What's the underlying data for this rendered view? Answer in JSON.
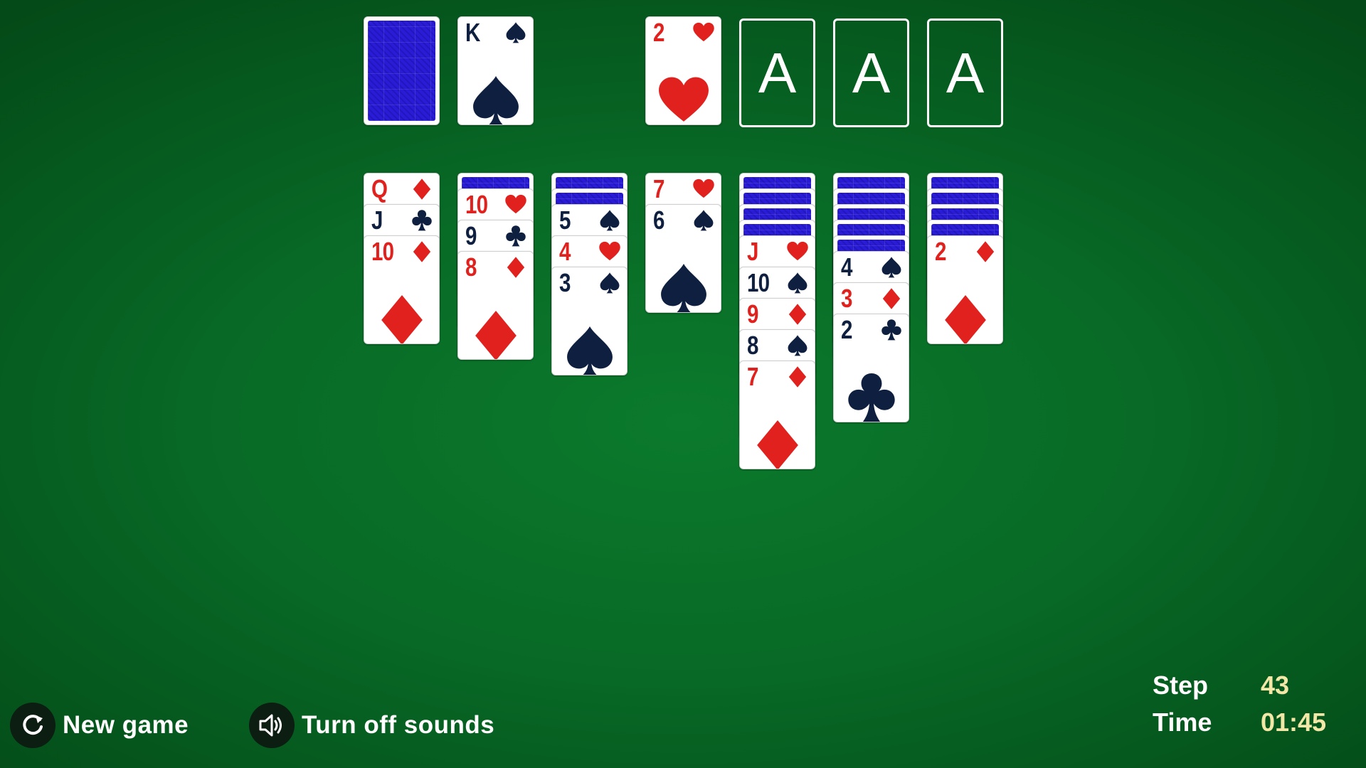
{
  "game": "Solitaire",
  "colors": {
    "table": "#086a26",
    "card_back": "#2a1cd6",
    "red_suit": "#e0211d",
    "black_suit": "#0e1f40",
    "stat_value": "#f2e7a6"
  },
  "stock": {
    "face_down": true
  },
  "waste": {
    "rank": "K",
    "suit": "spade"
  },
  "foundations": [
    {
      "rank": "2",
      "suit": "heart"
    },
    {
      "placeholder": "A"
    },
    {
      "placeholder": "A"
    },
    {
      "placeholder": "A"
    }
  ],
  "tableau": [
    {
      "hidden": 0,
      "cards": [
        {
          "rank": "Q",
          "suit": "diamond"
        },
        {
          "rank": "J",
          "suit": "club"
        },
        {
          "rank": "10",
          "suit": "diamond"
        }
      ]
    },
    {
      "hidden": 1,
      "cards": [
        {
          "rank": "10",
          "suit": "heart"
        },
        {
          "rank": "9",
          "suit": "club"
        },
        {
          "rank": "8",
          "suit": "diamond"
        }
      ]
    },
    {
      "hidden": 2,
      "cards": [
        {
          "rank": "5",
          "suit": "spade"
        },
        {
          "rank": "4",
          "suit": "heart"
        },
        {
          "rank": "3",
          "suit": "spade"
        }
      ]
    },
    {
      "hidden": 0,
      "cards": [
        {
          "rank": "7",
          "suit": "heart"
        },
        {
          "rank": "6",
          "suit": "spade"
        }
      ]
    },
    {
      "hidden": 4,
      "cards": [
        {
          "rank": "J",
          "suit": "heart"
        },
        {
          "rank": "10",
          "suit": "spade"
        },
        {
          "rank": "9",
          "suit": "diamond"
        },
        {
          "rank": "8",
          "suit": "spade"
        },
        {
          "rank": "7",
          "suit": "diamond"
        }
      ]
    },
    {
      "hidden": 5,
      "cards": [
        {
          "rank": "4",
          "suit": "spade"
        },
        {
          "rank": "3",
          "suit": "diamond"
        },
        {
          "rank": "2",
          "suit": "club"
        }
      ]
    },
    {
      "hidden": 4,
      "cards": [
        {
          "rank": "2",
          "suit": "diamond"
        }
      ]
    }
  ],
  "controls": {
    "new_game_label": "New game",
    "new_game_icon": "refresh-icon",
    "sound_label": "Turn off sounds",
    "sound_icon": "speaker-icon"
  },
  "stats": {
    "step_label": "Step",
    "step_value": "43",
    "time_label": "Time",
    "time_value": "01:45"
  }
}
